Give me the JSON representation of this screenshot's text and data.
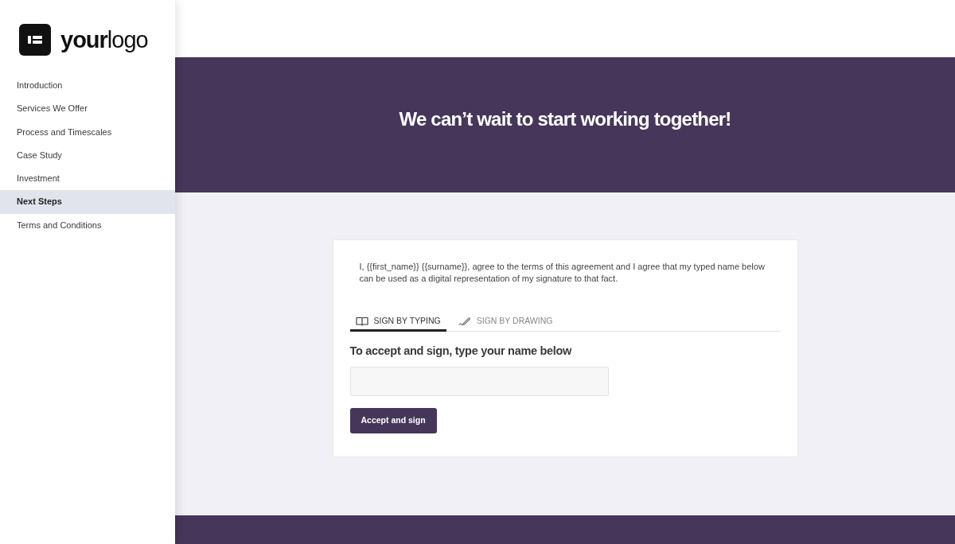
{
  "sidebar": {
    "logo": {
      "text": "**your**logo"
    },
    "items": [
      {
        "label": "Introduction",
        "selected": false
      },
      {
        "label": "Services We Offer",
        "selected": false
      },
      {
        "label": "Process and Timescales",
        "selected": false
      },
      {
        "label": "Case Study",
        "selected": false
      },
      {
        "label": "Investment",
        "selected": false
      },
      {
        "label": "Next Steps",
        "selected": true
      },
      {
        "label": "Terms and Conditions",
        "selected": false
      }
    ]
  },
  "hero": {
    "title": "We can’t wait to start working together!"
  },
  "signature_card": {
    "agreement_text": "I, {{first_name}} {{surname}}, agree to the terms of this agreement and I agree that my typed name below can be used as a digital representation of my signature to that fact.",
    "tabs": [
      {
        "label": "SIGN BY TYPING",
        "kind": "typing",
        "selected": true
      },
      {
        "label": "SIGN BY DRAWING",
        "kind": "drawing",
        "selected": false
      }
    ],
    "heading": "To accept and sign, type your name below",
    "button": "Accept and sign"
  }
}
